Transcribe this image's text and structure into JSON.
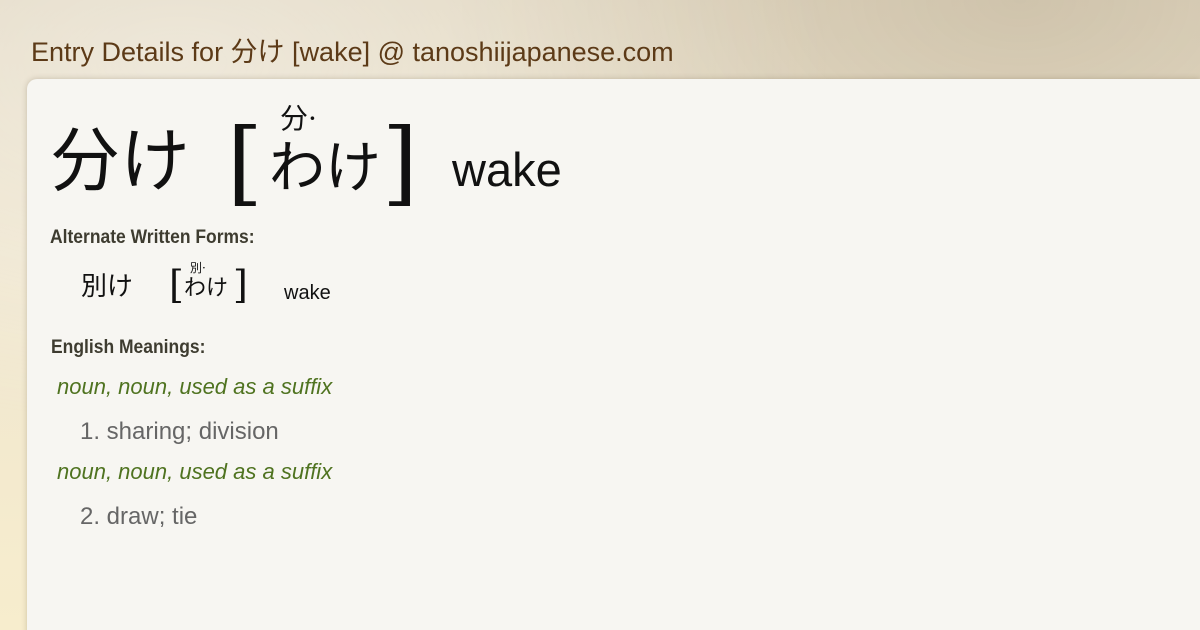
{
  "page": {
    "title": "Entry Details for 分け [wake] @ tanoshiijapanese.com"
  },
  "entry": {
    "word": "分け",
    "reading_ruby": "分·",
    "reading": "わけ",
    "romaji": "wake"
  },
  "alternate_forms": {
    "label": "Alternate Written Forms:",
    "items": [
      {
        "word": "別け",
        "reading_ruby": "別·",
        "reading": "わけ",
        "romaji": "wake"
      }
    ]
  },
  "english_meanings": {
    "label": "English Meanings:",
    "senses": [
      {
        "pos": "noun, noun, used as a suffix",
        "number": "1.",
        "gloss": "sharing; division",
        "text": "1. sharing; division"
      },
      {
        "pos": "noun, noun, used as a suffix",
        "number": "2.",
        "gloss": "draw; tie",
        "text": "2. draw; tie"
      }
    ]
  },
  "colors": {
    "title": "#5c3a17",
    "card_background": "#f7f6f2",
    "part_of_speech": "#4f7320",
    "meaning_text": "#666666",
    "section_label": "#3e3c30"
  }
}
